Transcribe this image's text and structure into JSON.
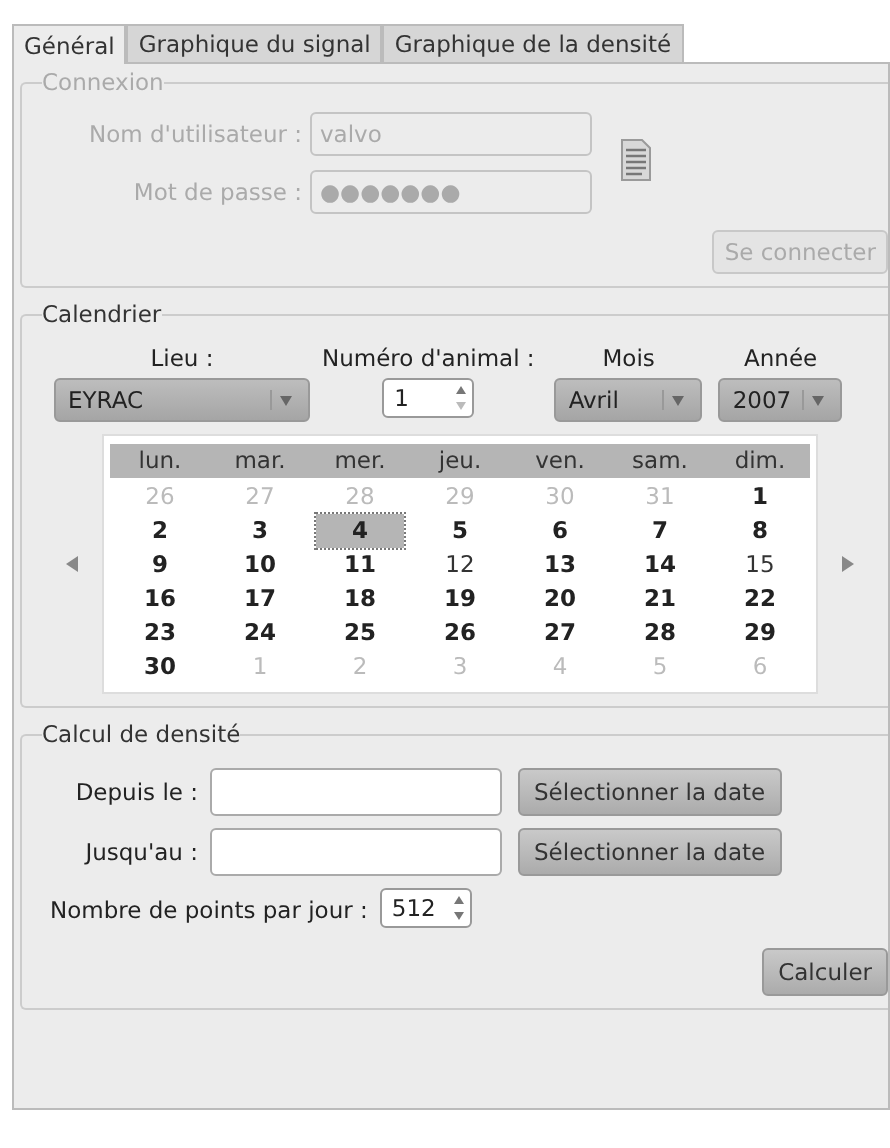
{
  "tabs": [
    {
      "label": "Général",
      "selected": true
    },
    {
      "label": "Graphique du signal",
      "selected": false
    },
    {
      "label": "Graphique de la densité",
      "selected": false
    }
  ],
  "connexion": {
    "title": "Connexion",
    "disabled": true,
    "username_label": "Nom d'utilisateur :",
    "username": "valvo",
    "password_label": "Mot de passe :",
    "password": "●●●●●●●",
    "button": "Se connecter"
  },
  "calendrier": {
    "title": "Calendrier",
    "lieu_label": "Lieu :",
    "lieu": "EYRAC",
    "animal_label": "Numéro d'animal :",
    "animal": "1",
    "mois_label": "Mois",
    "mois": "Avril",
    "annee_label": "Année",
    "annee": "2007",
    "weekdays": [
      "lun.",
      "mar.",
      "mer.",
      "jeu.",
      "ven.",
      "sam.",
      "dim."
    ],
    "days": [
      {
        "day": "26",
        "outside": true,
        "marked": false,
        "selected": false
      },
      {
        "day": "27",
        "outside": true,
        "marked": false,
        "selected": false
      },
      {
        "day": "28",
        "outside": true,
        "marked": false,
        "selected": false
      },
      {
        "day": "29",
        "outside": true,
        "marked": false,
        "selected": false
      },
      {
        "day": "30",
        "outside": true,
        "marked": false,
        "selected": false
      },
      {
        "day": "31",
        "outside": true,
        "marked": false,
        "selected": false
      },
      {
        "day": "1",
        "outside": false,
        "marked": true,
        "selected": false
      },
      {
        "day": "2",
        "outside": false,
        "marked": true,
        "selected": false
      },
      {
        "day": "3",
        "outside": false,
        "marked": true,
        "selected": false
      },
      {
        "day": "4",
        "outside": false,
        "marked": true,
        "selected": true
      },
      {
        "day": "5",
        "outside": false,
        "marked": true,
        "selected": false
      },
      {
        "day": "6",
        "outside": false,
        "marked": true,
        "selected": false
      },
      {
        "day": "7",
        "outside": false,
        "marked": true,
        "selected": false
      },
      {
        "day": "8",
        "outside": false,
        "marked": true,
        "selected": false
      },
      {
        "day": "9",
        "outside": false,
        "marked": true,
        "selected": false
      },
      {
        "day": "10",
        "outside": false,
        "marked": true,
        "selected": false
      },
      {
        "day": "11",
        "outside": false,
        "marked": true,
        "selected": false
      },
      {
        "day": "12",
        "outside": false,
        "marked": false,
        "selected": false
      },
      {
        "day": "13",
        "outside": false,
        "marked": true,
        "selected": false
      },
      {
        "day": "14",
        "outside": false,
        "marked": true,
        "selected": false
      },
      {
        "day": "15",
        "outside": false,
        "marked": false,
        "selected": false
      },
      {
        "day": "16",
        "outside": false,
        "marked": true,
        "selected": false
      },
      {
        "day": "17",
        "outside": false,
        "marked": true,
        "selected": false
      },
      {
        "day": "18",
        "outside": false,
        "marked": true,
        "selected": false
      },
      {
        "day": "19",
        "outside": false,
        "marked": true,
        "selected": false
      },
      {
        "day": "20",
        "outside": false,
        "marked": true,
        "selected": false
      },
      {
        "day": "21",
        "outside": false,
        "marked": true,
        "selected": false
      },
      {
        "day": "22",
        "outside": false,
        "marked": true,
        "selected": false
      },
      {
        "day": "23",
        "outside": false,
        "marked": true,
        "selected": false
      },
      {
        "day": "24",
        "outside": false,
        "marked": true,
        "selected": false
      },
      {
        "day": "25",
        "outside": false,
        "marked": true,
        "selected": false
      },
      {
        "day": "26",
        "outside": false,
        "marked": true,
        "selected": false
      },
      {
        "day": "27",
        "outside": false,
        "marked": true,
        "selected": false
      },
      {
        "day": "28",
        "outside": false,
        "marked": true,
        "selected": false
      },
      {
        "day": "29",
        "outside": false,
        "marked": true,
        "selected": false
      },
      {
        "day": "30",
        "outside": false,
        "marked": true,
        "selected": false
      },
      {
        "day": "1",
        "outside": true,
        "marked": false,
        "selected": false
      },
      {
        "day": "2",
        "outside": true,
        "marked": false,
        "selected": false
      },
      {
        "day": "3",
        "outside": true,
        "marked": false,
        "selected": false
      },
      {
        "day": "4",
        "outside": true,
        "marked": false,
        "selected": false
      },
      {
        "day": "5",
        "outside": true,
        "marked": false,
        "selected": false
      },
      {
        "day": "6",
        "outside": true,
        "marked": false,
        "selected": false
      }
    ]
  },
  "densite": {
    "title": "Calcul de densité",
    "from_label": "Depuis le :",
    "to_label": "Jusqu'au :",
    "select_button": "Sélectionner la date",
    "select_button_2": "Sélectionner la date",
    "points_label": "Nombre de points par jour :",
    "points": "512",
    "button": "Calculer"
  }
}
